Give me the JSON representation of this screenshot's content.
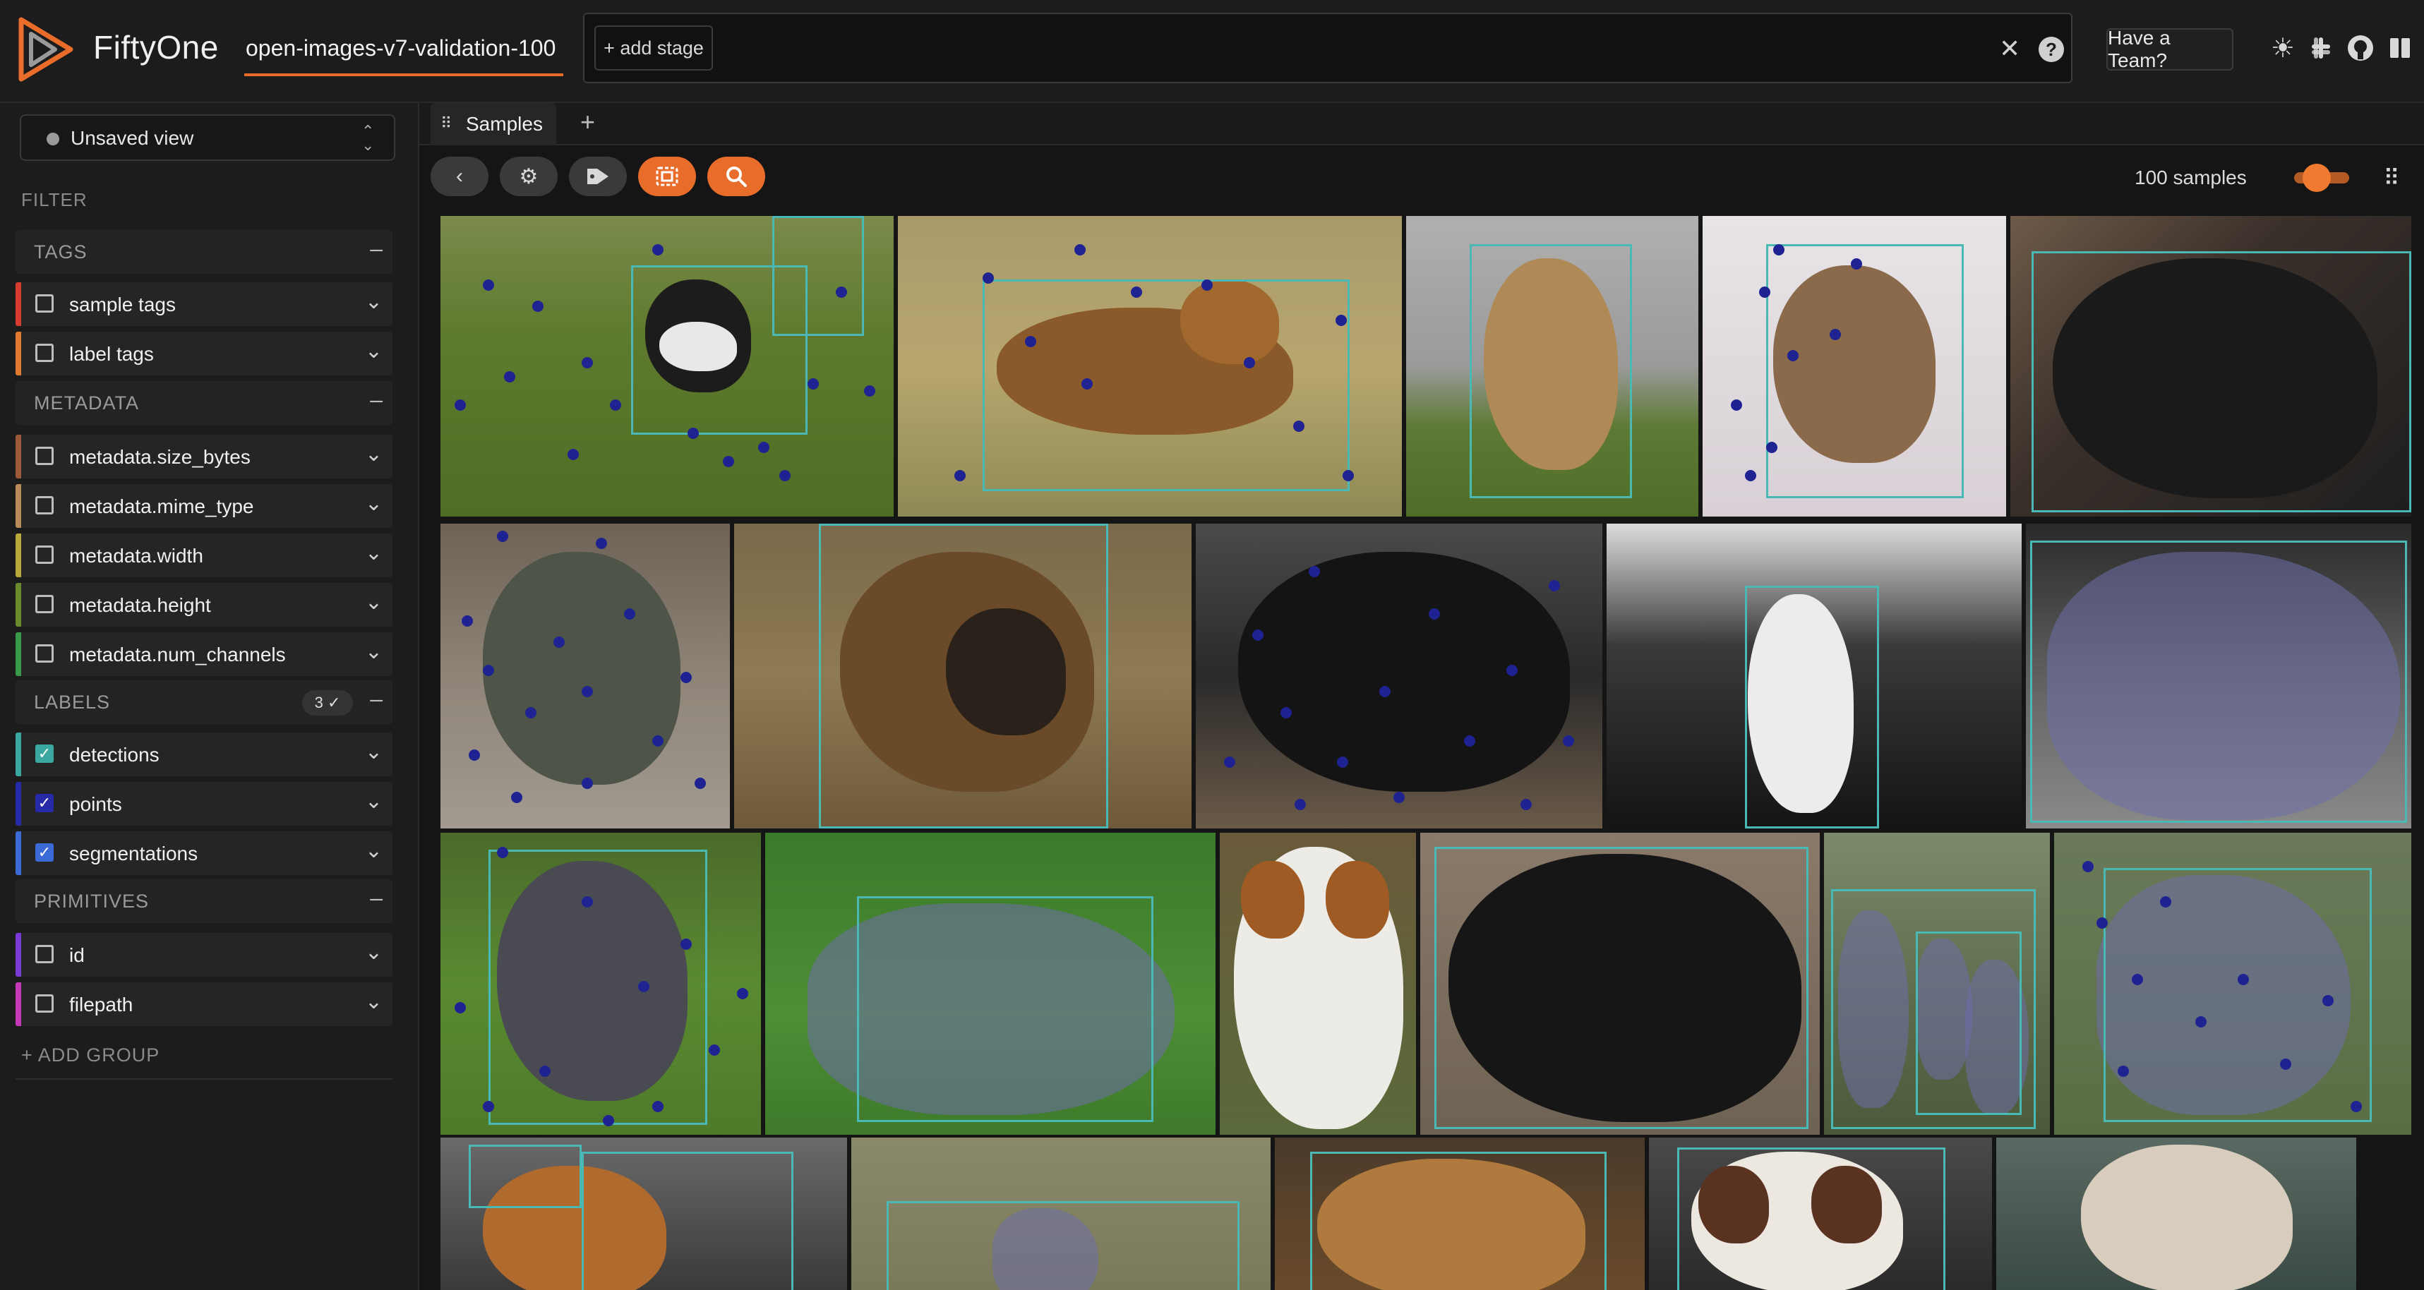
{
  "app": {
    "name": "FiftyOne",
    "dataset": "open-images-v7-validation-100"
  },
  "toolbar": {
    "add_stage": "+ add stage",
    "have_a_team": "Have a Team?"
  },
  "icons": {
    "clear": "close-icon",
    "help": "help-icon",
    "theme": "sun-icon",
    "slack": "slack-icon",
    "github": "github-icon",
    "docs": "book-icon"
  },
  "sidebar": {
    "view": {
      "label": "Unsaved view"
    },
    "filter_heading": "FILTER",
    "groups": [
      {
        "title": "TAGS",
        "fields": [
          {
            "label": "sample tags",
            "color": "#d63b2f",
            "checked": false
          },
          {
            "label": "label tags",
            "color": "#e07a2e",
            "checked": false
          }
        ]
      },
      {
        "title": "METADATA",
        "fields": [
          {
            "label": "metadata.size_bytes",
            "color": "#9c5a3a",
            "checked": false
          },
          {
            "label": "metadata.mime_type",
            "color": "#b98a5a",
            "checked": false
          },
          {
            "label": "metadata.width",
            "color": "#b8a83a",
            "checked": false
          },
          {
            "label": "metadata.height",
            "color": "#6a8a2e",
            "checked": false
          },
          {
            "label": "metadata.num_channels",
            "color": "#3a9a4a",
            "checked": false
          }
        ]
      },
      {
        "title": "LABELS",
        "badge": "3 ✓",
        "fields": [
          {
            "label": "detections",
            "color": "#3aa8a0",
            "checked": true
          },
          {
            "label": "points",
            "color": "#262aa6",
            "checked": true
          },
          {
            "label": "segmentations",
            "color": "#3a6ad6",
            "checked": true
          }
        ]
      },
      {
        "title": "PRIMITIVES",
        "fields": [
          {
            "label": "id",
            "color": "#7a3ad6",
            "checked": false
          },
          {
            "label": "filepath",
            "color": "#c43ab8",
            "checked": false
          }
        ]
      }
    ],
    "add_group": "+ ADD GROUP"
  },
  "tabs": {
    "samples": "Samples"
  },
  "grid": {
    "sample_count": "100 samples"
  }
}
